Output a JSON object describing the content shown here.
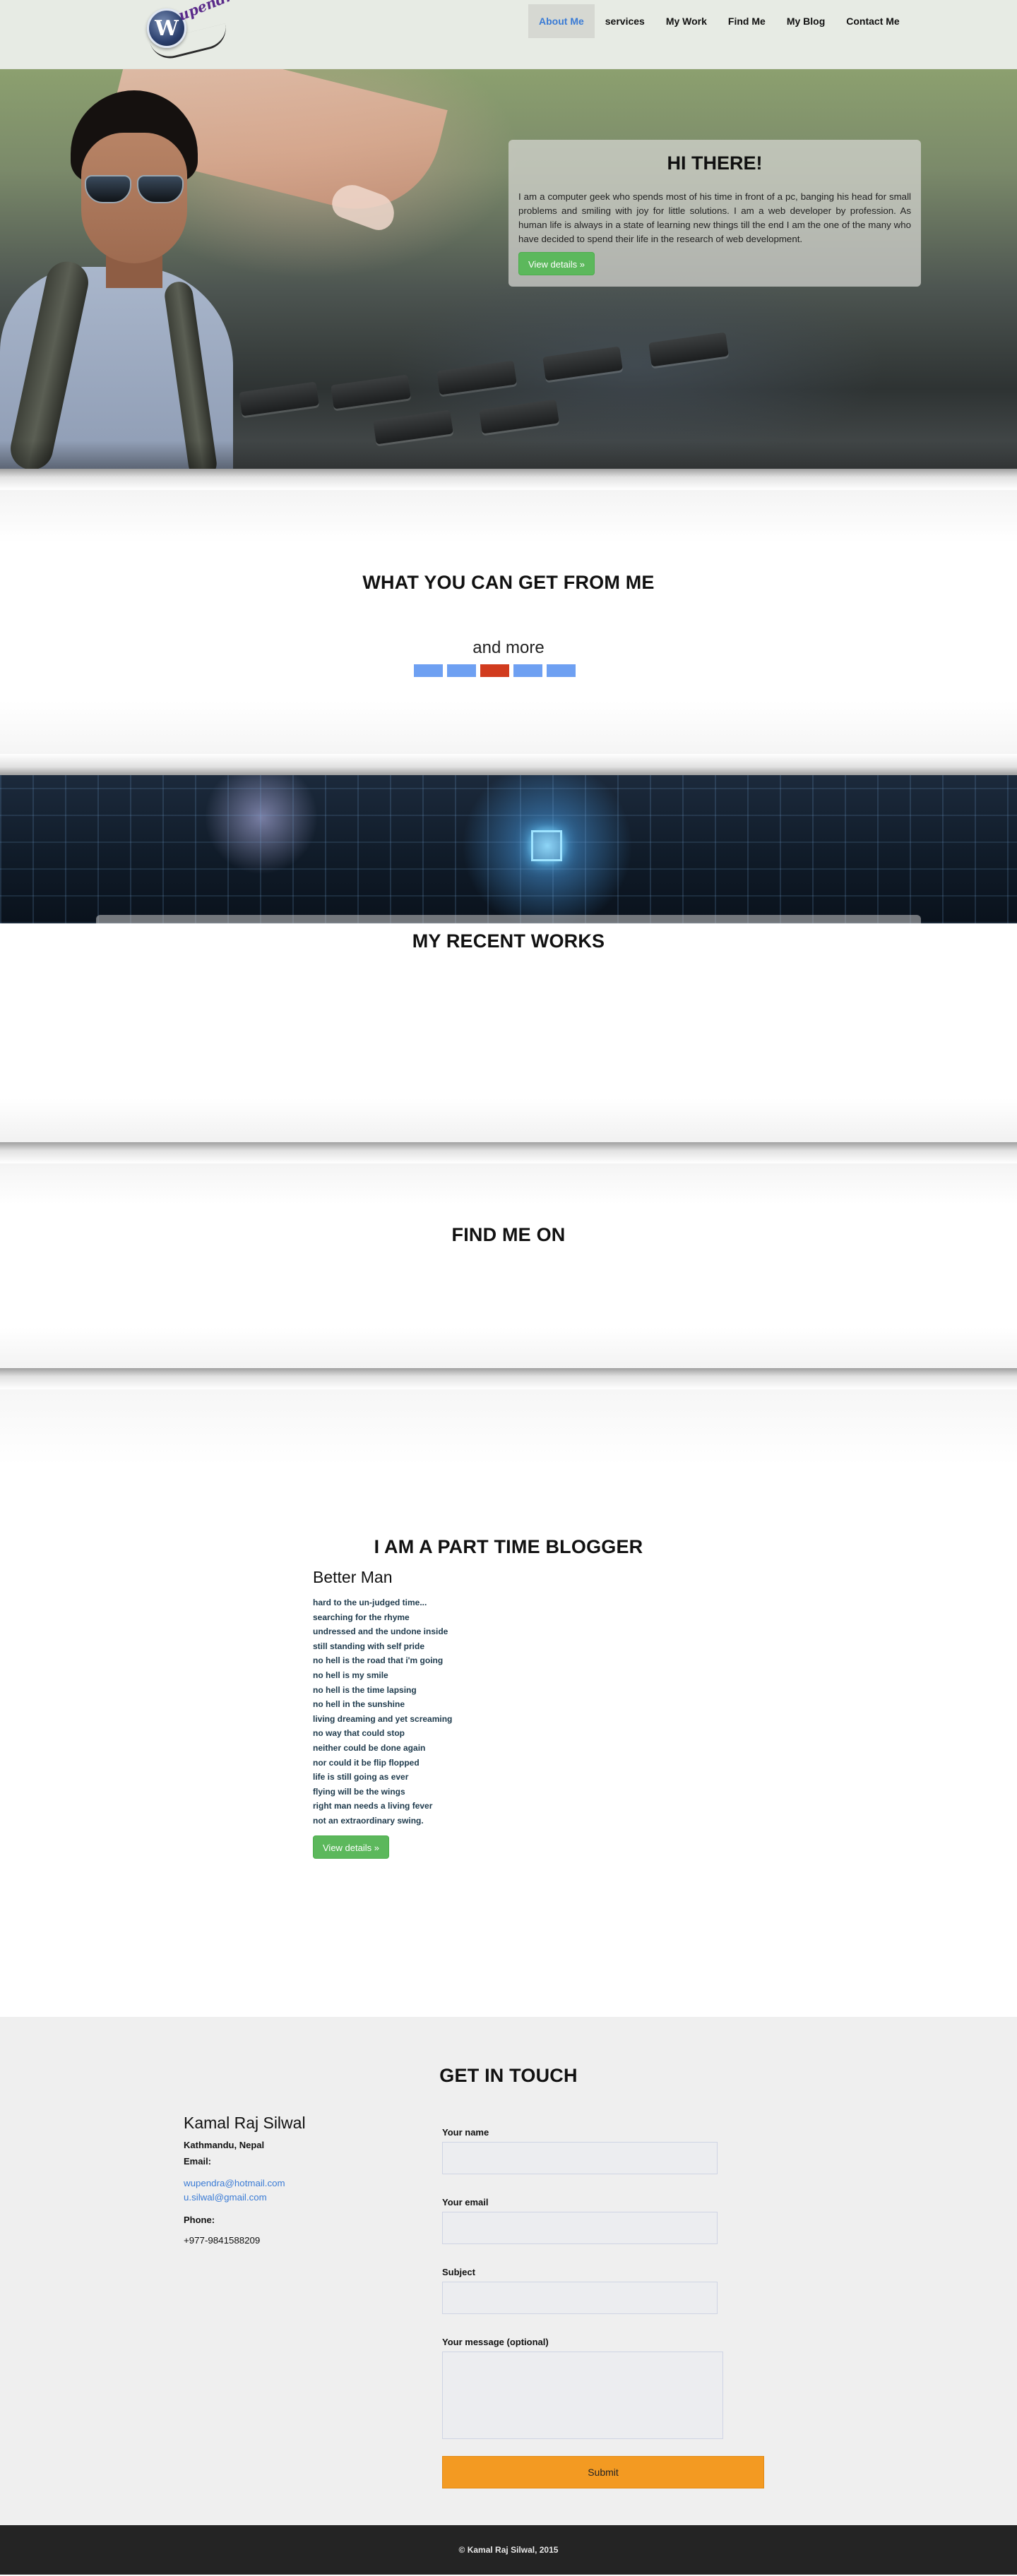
{
  "logo": {
    "mark": "W",
    "word": "upendra"
  },
  "nav": {
    "items": [
      {
        "label": "About Me",
        "active": true
      },
      {
        "label": "services",
        "active": false
      },
      {
        "label": "My Work",
        "active": false
      },
      {
        "label": "Find Me",
        "active": false
      },
      {
        "label": "My Blog",
        "active": false
      },
      {
        "label": "Contact Me",
        "active": false
      }
    ]
  },
  "hero": {
    "title": "HI THERE!",
    "text": "I am a computer geek who spends most of his time in front of a pc, banging his head for small problems and smiling with joy for little solutions. I am a web developer by profession. As human life is always in a state of learning new things till the end I am the one of the many who have decided to spend their life in the research of web development.",
    "button": "View details »"
  },
  "services": {
    "title": "WHAT YOU CAN GET FROM ME",
    "subtitle": "and more",
    "indicators": 5,
    "active_indicator": 2
  },
  "works": {
    "title": "MY RECENT WORKS"
  },
  "findme": {
    "title": "FIND ME ON"
  },
  "blog": {
    "title": "I AM A PART TIME BLOGGER",
    "post_title": "Better Man",
    "lines": [
      "hard to the un-judged time...",
      "searching for the rhyme",
      "undressed and the undone inside",
      "still standing with self pride",
      "no hell is the road that i'm going",
      "no hell is my smile",
      "no hell is the time lapsing",
      "no hell in the sunshine",
      "living dreaming and yet screaming",
      "no way that could stop",
      "neither could be done again",
      "nor could it be flip flopped",
      "life is still going as ever",
      "flying will be the wings",
      "right man needs a living fever",
      "not an extraordinary swing."
    ],
    "button": "View details »"
  },
  "contact": {
    "title": "GET IN TOUCH",
    "name": "Kamal Raj Silwal",
    "address": "Kathmandu, Nepal",
    "email_label": "Email:",
    "emails": [
      "wupendra@hotmail.com",
      "u.silwal@gmail.com"
    ],
    "phone_label": "Phone:",
    "phone": "+977-9841588209",
    "form": {
      "name_label": "Your name",
      "email_label": "Your email",
      "subject_label": "Subject",
      "message_label": "Your message (optional)",
      "submit": "Submit"
    }
  },
  "footer": {
    "text": "© Kamal Raj Silwal, 2015"
  },
  "colors": {
    "accent": "#3a7bd5",
    "button_green": "#5cb85c",
    "submit_orange": "#f39a22",
    "footer_bg": "#242424"
  }
}
